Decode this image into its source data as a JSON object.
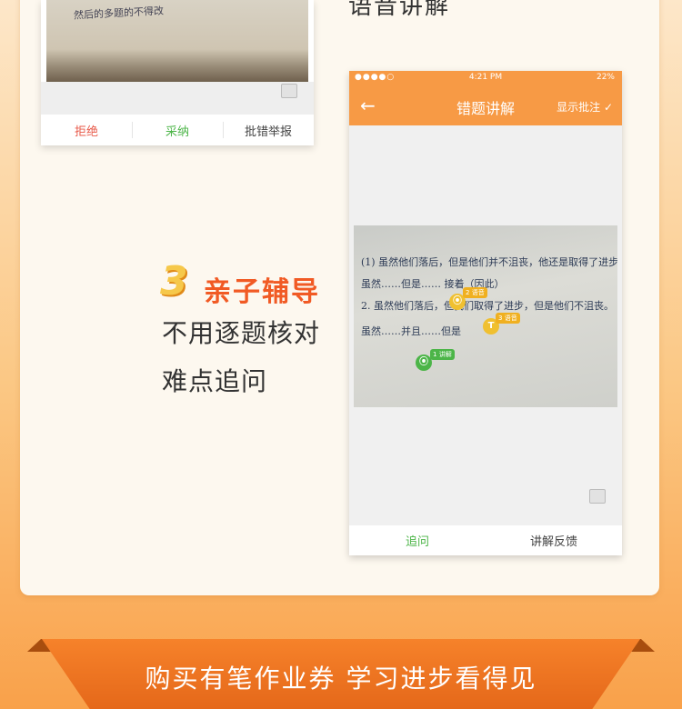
{
  "top_heading": "语音讲解",
  "left_phone": {
    "photo_scribble": "然后的多题的不得改",
    "tabs": [
      {
        "label": "拒绝",
        "color": "#e85a4a"
      },
      {
        "label": "采纳",
        "color": "#4cb548"
      },
      {
        "label": "批错举报",
        "color": "#444444"
      }
    ]
  },
  "feature": {
    "number": "3",
    "title": "亲子辅导",
    "lines": [
      "不用逐题核对",
      "难点追问"
    ]
  },
  "right_phone": {
    "status": {
      "signal": "●●●●○",
      "time": "4:21 PM",
      "battery": "22%"
    },
    "nav": {
      "back": "←",
      "title": "错题讲解",
      "right": "显示批注 ✓"
    },
    "photo_lines": [
      "(1) 虽然他们落后，但是他们并不沮丧，他还是取得了进步。",
      "    虽然……但是……  接着（因此）",
      "2. 虽然他们落后，但我们取得了进步，但是他们不沮丧。",
      "    虽然……并且……但是"
    ],
    "pins": [
      {
        "num": "2",
        "tag": "语音"
      },
      {
        "num": "3",
        "tag": "语音"
      },
      {
        "num": "1",
        "tag": "讲解"
      }
    ],
    "tabs": [
      {
        "label": "追问",
        "color": "#4cb548"
      },
      {
        "label": "讲解反馈",
        "color": "#444444"
      }
    ]
  },
  "banner": {
    "text": "购买有笔作业券 学习进步看得见"
  },
  "colors": {
    "accent": "#f79a45",
    "brand_orange": "#f15a24"
  }
}
